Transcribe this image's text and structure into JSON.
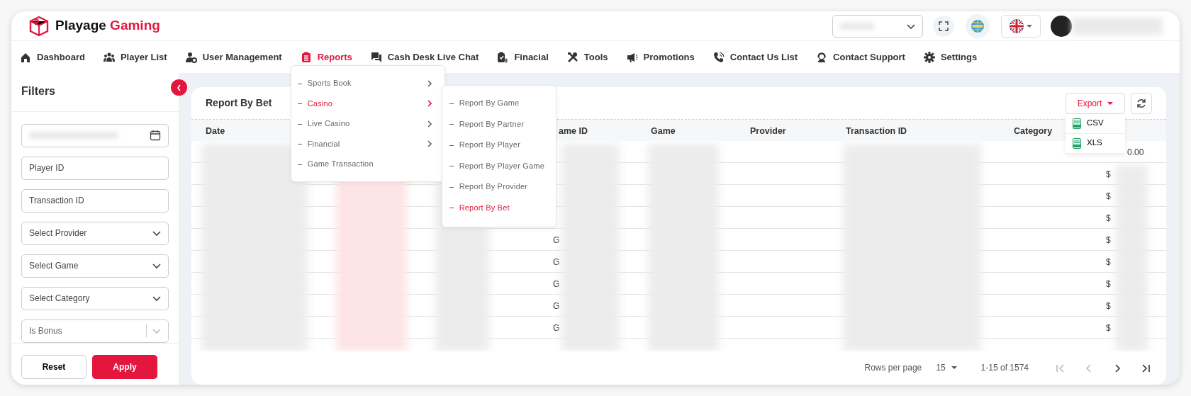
{
  "brand": {
    "name": "Playage",
    "accent": "Gaming"
  },
  "nav": [
    {
      "label": "Dashboard",
      "selected": false
    },
    {
      "label": "Player List",
      "selected": false
    },
    {
      "label": "User Management",
      "selected": false
    },
    {
      "label": "Reports",
      "selected": true,
      "expanded": true,
      "children": [
        {
          "label": "Sports Book",
          "has_submenu": true,
          "selected": false
        },
        {
          "label": "Casino",
          "has_submenu": true,
          "selected": true,
          "expanded": true,
          "children": [
            {
              "label": "Report By Game",
              "selected": false
            },
            {
              "label": "Report By Partner",
              "selected": false
            },
            {
              "label": "Report By Player",
              "selected": false
            },
            {
              "label": "Report By Player Game",
              "selected": false
            },
            {
              "label": "Report By Provider",
              "selected": false
            },
            {
              "label": "Report By Bet",
              "selected": true
            }
          ]
        },
        {
          "label": "Live Casino",
          "has_submenu": true,
          "selected": false
        },
        {
          "label": "Financial",
          "has_submenu": true,
          "selected": false
        },
        {
          "label": "Game Transaction",
          "has_submenu": false,
          "selected": false
        }
      ]
    },
    {
      "label": "Cash Desk Live Chat",
      "selected": false
    },
    {
      "label": "Finacial",
      "selected": false
    },
    {
      "label": "Tools",
      "selected": false
    },
    {
      "label": "Promotions",
      "selected": false
    },
    {
      "label": "Contact Us List",
      "selected": false
    },
    {
      "label": "Contact Support",
      "selected": false
    },
    {
      "label": "Settings",
      "selected": false
    }
  ],
  "filters": {
    "title": "Filters",
    "fields": [
      {
        "kind": "date"
      },
      {
        "kind": "text",
        "placeholder": "Player ID"
      },
      {
        "kind": "text",
        "placeholder": "Transaction ID"
      },
      {
        "kind": "select",
        "placeholder": "Select Provider"
      },
      {
        "kind": "select",
        "placeholder": "Select Game"
      },
      {
        "kind": "select",
        "placeholder": "Select Category"
      },
      {
        "kind": "multiselect",
        "placeholder": "Is Bonus"
      }
    ],
    "buttons": [
      {
        "label": "Reset",
        "kind": "secondary"
      },
      {
        "label": "Apply",
        "kind": "primary"
      }
    ]
  },
  "report": {
    "title": "Report By Bet",
    "export": {
      "label": "Export",
      "expanded": true,
      "options": [
        "CSV",
        "XLS"
      ]
    },
    "columns": [
      {
        "label": "Date"
      },
      {
        "label": "ame ID"
      },
      {
        "label": "Game"
      },
      {
        "label": "Provider"
      },
      {
        "label": "Transaction ID"
      },
      {
        "label": "Category"
      }
    ],
    "rows": [
      {
        "amount": "0.00"
      },
      {
        "amount": "$"
      },
      {
        "amount": "$"
      },
      {
        "amount": "$"
      },
      {
        "game_id": "G",
        "amount": "$"
      },
      {
        "game_id": "G",
        "amount": "$"
      },
      {
        "game_id": "G",
        "amount": "$"
      },
      {
        "game_id": "G",
        "amount": "$"
      },
      {
        "game_id": "G",
        "amount": "$"
      }
    ],
    "footer": {
      "rows_per_page_label": "Rows per page",
      "rows_per_page": "15",
      "range": "1-15 of 1574"
    }
  }
}
